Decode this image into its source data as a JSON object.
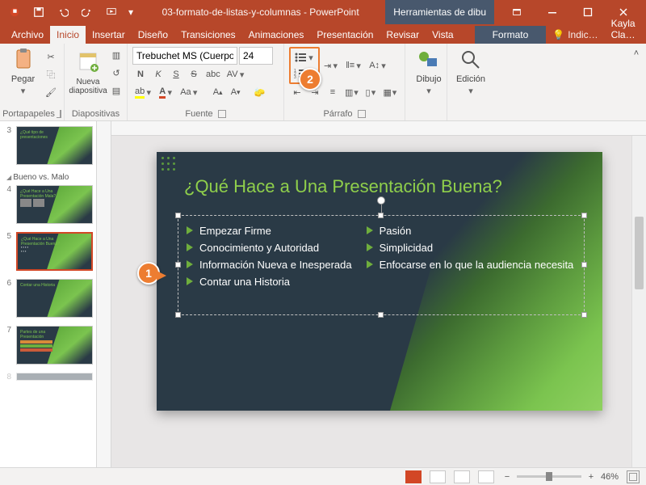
{
  "titlebar": {
    "doc_title": "03-formato-de-listas-y-columnas - PowerPoint",
    "context_title": "Herramientas de dibu"
  },
  "tabs": {
    "file": "Archivo",
    "home": "Inicio",
    "insert": "Insertar",
    "design": "Diseño",
    "transitions": "Transiciones",
    "animations": "Animaciones",
    "slideshow": "Presentación",
    "review": "Revisar",
    "view": "Vista",
    "format": "Formato",
    "tellme": "Indic…",
    "account": "Kayla Cla…"
  },
  "ribbon": {
    "clipboard": {
      "paste": "Pegar",
      "label": "Portapapeles"
    },
    "slides": {
      "new_slide": "Nueva diapositiva",
      "label": "Diapositivas"
    },
    "font": {
      "name": "Trebuchet MS (Cuerpo",
      "size": "24",
      "bold": "N",
      "italic": "K",
      "underline": "S",
      "strike": "S",
      "label": "Fuente"
    },
    "paragraph": {
      "label": "Párrafo"
    },
    "drawing": {
      "label": "Dibujo",
      "btn": "Dibujo"
    },
    "editing": {
      "label": "Edición",
      "btn": "Edición"
    }
  },
  "callouts": {
    "one": "1",
    "two": "2"
  },
  "thumbs": {
    "section": "Bueno vs. Malo",
    "n3": "3",
    "n4": "4",
    "n5": "5",
    "n6": "6",
    "n7": "7",
    "n8": "8"
  },
  "slide": {
    "title": "¿Qué Hace a Una Presentación Buena?",
    "left": [
      "Empezar Firme",
      "Conocimiento y Autoridad",
      "Información Nueva e Inesperada",
      "Contar una Historia"
    ],
    "right": [
      "Pasión",
      "Simplicidad",
      "Enfocarse en lo que la audiencia necesita"
    ]
  },
  "status": {
    "zoom": "46%"
  }
}
